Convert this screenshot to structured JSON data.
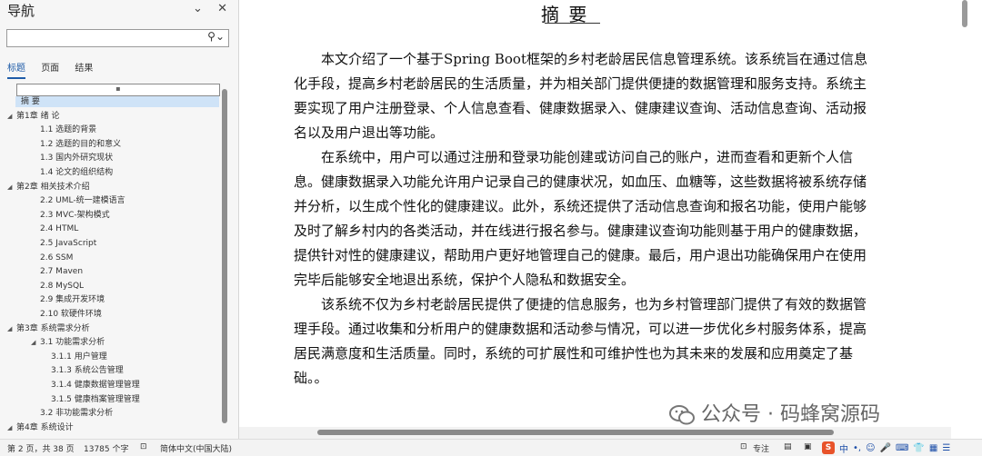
{
  "nav": {
    "title": "导航",
    "dropdown_icon": "chevron-down-icon",
    "close_icon": "close-icon",
    "search_placeholder": "",
    "tabs": [
      "标题",
      "页面",
      "结果"
    ],
    "items": [
      {
        "label": "摘  要",
        "level": 0,
        "arrow": ""
      },
      {
        "label": "第1章 绪  论",
        "level": 0,
        "arrow": "◢"
      },
      {
        "label": "1.1  选题的背景",
        "level": 1,
        "arrow": ""
      },
      {
        "label": "1.2  选题的目的和意义",
        "level": 1,
        "arrow": ""
      },
      {
        "label": "1.3  国内外研究现状",
        "level": 1,
        "arrow": ""
      },
      {
        "label": "1.4  论文的组织结构",
        "level": 1,
        "arrow": ""
      },
      {
        "label": "第2章  相关技术介绍",
        "level": 0,
        "arrow": "◢"
      },
      {
        "label": "2.2  UML-统一建模语言",
        "level": 1,
        "arrow": ""
      },
      {
        "label": "2.3  MVC-架构模式",
        "level": 1,
        "arrow": ""
      },
      {
        "label": "2.4  HTML",
        "level": 1,
        "arrow": ""
      },
      {
        "label": "2.5  JavaScript",
        "level": 1,
        "arrow": ""
      },
      {
        "label": "2.6 SSM",
        "level": 1,
        "arrow": ""
      },
      {
        "label": "2.7  Maven",
        "level": 1,
        "arrow": ""
      },
      {
        "label": "2.8  MySQL",
        "level": 1,
        "arrow": ""
      },
      {
        "label": "2.9  集成开发环境",
        "level": 1,
        "arrow": ""
      },
      {
        "label": "2.10  软硬件环境",
        "level": 1,
        "arrow": ""
      },
      {
        "label": "第3章 系统需求分析",
        "level": 0,
        "arrow": "◢"
      },
      {
        "label": "3.1  功能需求分析",
        "level": 1,
        "arrow": "◢"
      },
      {
        "label": "3.1.1  用户管理",
        "level": 2,
        "arrow": ""
      },
      {
        "label": "3.1.3  系统公告管理",
        "level": 2,
        "arrow": ""
      },
      {
        "label": "3.1.4  健康数据管理管理",
        "level": 2,
        "arrow": ""
      },
      {
        "label": "3.1.5  健康档案管理管理",
        "level": 2,
        "arrow": ""
      },
      {
        "label": "3.2  非功能需求分析",
        "level": 1,
        "arrow": ""
      },
      {
        "label": "第4章 系统设计",
        "level": 0,
        "arrow": "◢"
      }
    ]
  },
  "doc": {
    "title": "摘    要",
    "paragraphs": [
      "本文介绍了一个基于Spring Boot框架的乡村老龄居民信息管理系统。该系统旨在通过信息化手段，提高乡村老龄居民的生活质量，并为相关部门提供便捷的数据管理和服务支持。系统主要实现了用户注册登录、个人信息查看、健康数据录入、健康建议查询、活动信息查询、活动报名以及用户退出等功能。",
      "在系统中，用户可以通过注册和登录功能创建或访问自己的账户，进而查看和更新个人信息。健康数据录入功能允许用户记录自己的健康状况，如血压、血糖等，这些数据将被系统存储并分析，以生成个性化的健康建议。此外，系统还提供了活动信息查询和报名功能，使用户能够及时了解乡村内的各类活动，并在线进行报名参与。健康建议查询功能则基于用户的健康数据，提供针对性的健康建议，帮助用户更好地管理自己的健康。最后，用户退出功能确保用户在使用完毕后能够安全地退出系统，保护个人隐私和数据安全。",
      "该系统不仅为乡村老龄居民提供了便捷的信息服务，也为乡村管理部门提供了有效的数据管理手段。通过收集和分析用户的健康数据和活动参与情况，可以进一步优化乡村服务体系，提高居民满意度和生活质量。同时，系统的可扩展性和可维护性也为其未来的发展和应用奠定了基础。。"
    ],
    "watermark": "公众号 · 码蜂窝源码"
  },
  "status": {
    "page": "第 2 页，共 38 页",
    "words": "13785 个字",
    "language": "简体中文(中国大陆)",
    "focus": "专注",
    "ime_label": "中"
  }
}
